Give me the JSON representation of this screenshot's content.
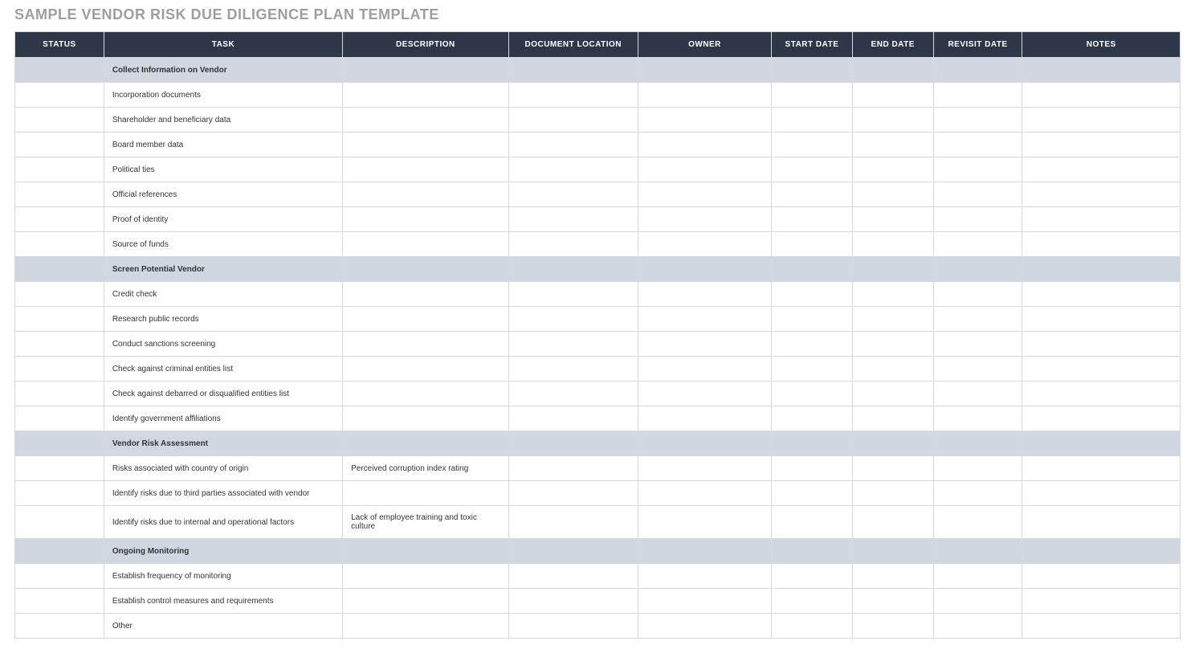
{
  "title": "SAMPLE VENDOR RISK DUE DILIGENCE PLAN TEMPLATE",
  "columns": [
    "STATUS",
    "TASK",
    "DESCRIPTION",
    "DOCUMENT LOCATION",
    "OWNER",
    "START DATE",
    "END DATE",
    "REVISIT DATE",
    "NOTES"
  ],
  "rows": [
    {
      "section": true,
      "status": "",
      "task": "Collect Information on Vendor",
      "description": "",
      "location": "",
      "owner": "",
      "start": "",
      "end": "",
      "revisit": "",
      "notes": ""
    },
    {
      "section": false,
      "status": "",
      "task": "Incorporation documents",
      "description": "",
      "location": "",
      "owner": "",
      "start": "",
      "end": "",
      "revisit": "",
      "notes": ""
    },
    {
      "section": false,
      "status": "",
      "task": "Shareholder and beneficiary data",
      "description": "",
      "location": "",
      "owner": "",
      "start": "",
      "end": "",
      "revisit": "",
      "notes": ""
    },
    {
      "section": false,
      "status": "",
      "task": "Board member data",
      "description": "",
      "location": "",
      "owner": "",
      "start": "",
      "end": "",
      "revisit": "",
      "notes": ""
    },
    {
      "section": false,
      "status": "",
      "task": "Political ties",
      "description": "",
      "location": "",
      "owner": "",
      "start": "",
      "end": "",
      "revisit": "",
      "notes": ""
    },
    {
      "section": false,
      "status": "",
      "task": "Official references",
      "description": "",
      "location": "",
      "owner": "",
      "start": "",
      "end": "",
      "revisit": "",
      "notes": ""
    },
    {
      "section": false,
      "status": "",
      "task": "Proof of identity",
      "description": "",
      "location": "",
      "owner": "",
      "start": "",
      "end": "",
      "revisit": "",
      "notes": ""
    },
    {
      "section": false,
      "status": "",
      "task": "Source of funds",
      "description": "",
      "location": "",
      "owner": "",
      "start": "",
      "end": "",
      "revisit": "",
      "notes": ""
    },
    {
      "section": true,
      "status": "",
      "task": "Screen Potential Vendor",
      "description": "",
      "location": "",
      "owner": "",
      "start": "",
      "end": "",
      "revisit": "",
      "notes": ""
    },
    {
      "section": false,
      "status": "",
      "task": "Credit check",
      "description": "",
      "location": "",
      "owner": "",
      "start": "",
      "end": "",
      "revisit": "",
      "notes": ""
    },
    {
      "section": false,
      "status": "",
      "task": "Research public records",
      "description": "",
      "location": "",
      "owner": "",
      "start": "",
      "end": "",
      "revisit": "",
      "notes": ""
    },
    {
      "section": false,
      "status": "",
      "task": "Conduct sanctions screening",
      "description": "",
      "location": "",
      "owner": "",
      "start": "",
      "end": "",
      "revisit": "",
      "notes": ""
    },
    {
      "section": false,
      "status": "",
      "task": "Check against criminal entities list",
      "description": "",
      "location": "",
      "owner": "",
      "start": "",
      "end": "",
      "revisit": "",
      "notes": ""
    },
    {
      "section": false,
      "status": "",
      "task": "Check against debarred or disqualified entities list",
      "description": "",
      "location": "",
      "owner": "",
      "start": "",
      "end": "",
      "revisit": "",
      "notes": ""
    },
    {
      "section": false,
      "status": "",
      "task": "Identify government affiliations",
      "description": "",
      "location": "",
      "owner": "",
      "start": "",
      "end": "",
      "revisit": "",
      "notes": ""
    },
    {
      "section": true,
      "status": "",
      "task": "Vendor Risk Assessment",
      "description": "",
      "location": "",
      "owner": "",
      "start": "",
      "end": "",
      "revisit": "",
      "notes": ""
    },
    {
      "section": false,
      "status": "",
      "task": "Risks associated with country of origin",
      "description": "Perceived corruption index rating",
      "location": "",
      "owner": "",
      "start": "",
      "end": "",
      "revisit": "",
      "notes": ""
    },
    {
      "section": false,
      "status": "",
      "task": "Identify risks due to third parties associated with vendor",
      "description": "",
      "location": "",
      "owner": "",
      "start": "",
      "end": "",
      "revisit": "",
      "notes": ""
    },
    {
      "section": false,
      "status": "",
      "task": "Identify risks due to internal and operational factors",
      "description": "Lack of employee training and toxic culture",
      "location": "",
      "owner": "",
      "start": "",
      "end": "",
      "revisit": "",
      "notes": ""
    },
    {
      "section": true,
      "status": "",
      "task": "Ongoing Monitoring",
      "description": "",
      "location": "",
      "owner": "",
      "start": "",
      "end": "",
      "revisit": "",
      "notes": ""
    },
    {
      "section": false,
      "status": "",
      "task": "Establish frequency of monitoring",
      "description": "",
      "location": "",
      "owner": "",
      "start": "",
      "end": "",
      "revisit": "",
      "notes": ""
    },
    {
      "section": false,
      "status": "",
      "task": "Establish control measures and requirements",
      "description": "",
      "location": "",
      "owner": "",
      "start": "",
      "end": "",
      "revisit": "",
      "notes": ""
    },
    {
      "section": false,
      "status": "",
      "task": "Other",
      "description": "",
      "location": "",
      "owner": "",
      "start": "",
      "end": "",
      "revisit": "",
      "notes": ""
    }
  ]
}
